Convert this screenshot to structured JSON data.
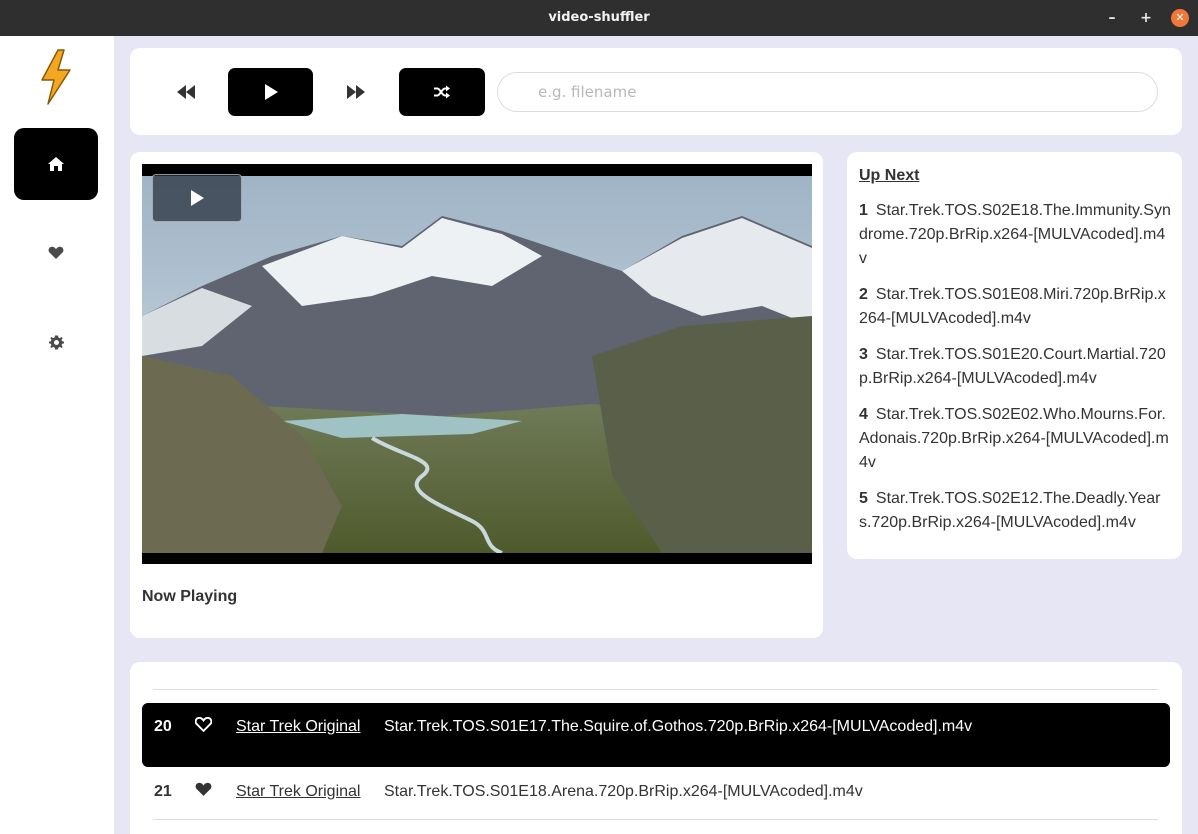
{
  "window": {
    "title": "video-shuffler",
    "minimize_label": "–",
    "maximize_label": "+",
    "close_label": "✕"
  },
  "sidebar": {
    "logo": "lightning-bolt-logo",
    "items": [
      {
        "name": "home",
        "icon": "home-icon",
        "active": true
      },
      {
        "name": "favorites",
        "icon": "heart-icon",
        "active": false
      },
      {
        "name": "settings",
        "icon": "gear-icon",
        "active": false
      }
    ]
  },
  "controls": {
    "prev_icon": "rewind-icon",
    "play_icon": "play-icon",
    "next_icon": "fast-forward-icon",
    "shuffle_icon": "shuffle-icon",
    "search": {
      "placeholder": "e.g. filename",
      "value": ""
    }
  },
  "player": {
    "now_playing_label": "Now Playing",
    "play_icon": "play-icon"
  },
  "up_next": {
    "title": "Up Next",
    "items": [
      {
        "num": "1",
        "file": "Star.Trek.TOS.S02E18.The.Immunity.Syndrome.720p.BrRip.x264-[MULVAcoded].m4v"
      },
      {
        "num": "2",
        "file": "Star.Trek.TOS.S01E08.Miri.720p.BrRip.x264-[MULVAcoded].m4v"
      },
      {
        "num": "3",
        "file": "Star.Trek.TOS.S01E20.Court.Martial.720p.BrRip.x264-[MULVAcoded].m4v"
      },
      {
        "num": "4",
        "file": "Star.Trek.TOS.S02E02.Who.Mourns.For.Adonais.720p.BrRip.x264-[MULVAcoded].m4v"
      },
      {
        "num": "5",
        "file": "Star.Trek.TOS.S02E12.The.Deadly.Years.720p.BrRip.x264-[MULVAcoded].m4v"
      }
    ]
  },
  "library": {
    "rows": [
      {
        "index": "20",
        "show": "Star Trek Original",
        "file": "Star.Trek.TOS.S01E17.The.Squire.of.Gothos.720p.BrRip.x264-[MULVAcoded].m4v",
        "active": true
      },
      {
        "index": "21",
        "show": "Star Trek Original",
        "file": "Star.Trek.TOS.S01E18.Arena.720p.BrRip.x264-[MULVAcoded].m4v",
        "active": false
      }
    ]
  },
  "colors": {
    "accent": "#000000",
    "background": "#e6e6f5",
    "logo_orange": "#f5a623",
    "close_button": "#f0763a"
  }
}
